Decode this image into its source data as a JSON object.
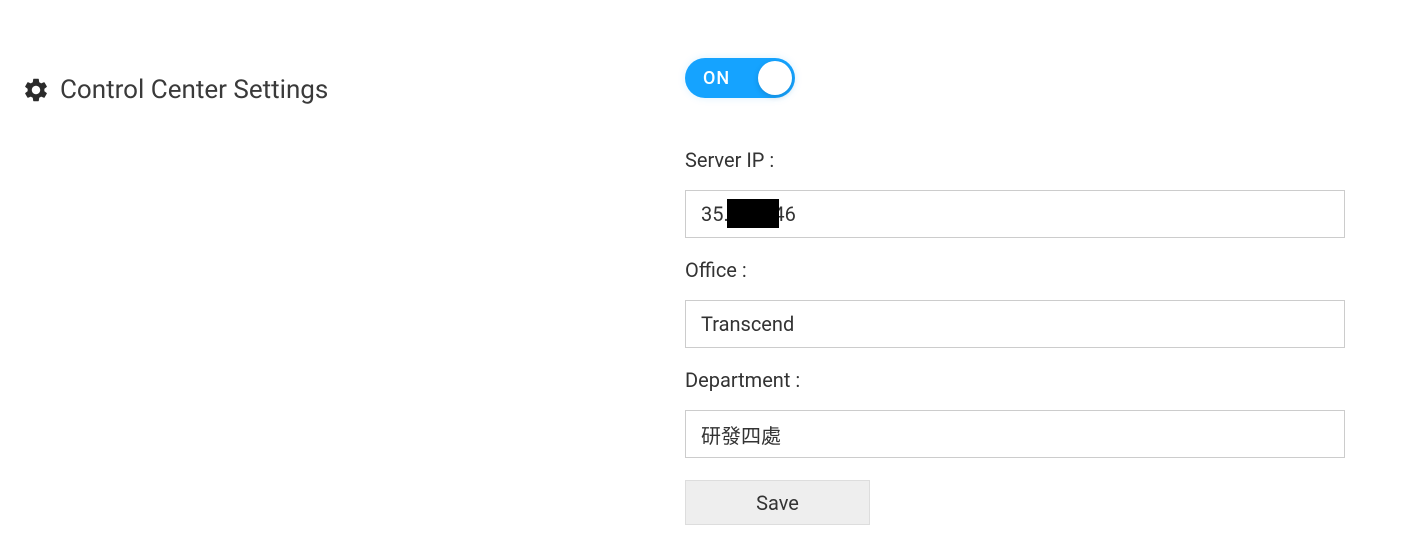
{
  "header": {
    "title": "Control Center Settings"
  },
  "toggle": {
    "state_label": "ON",
    "active": true
  },
  "form": {
    "server_ip": {
      "label": "Server IP :",
      "value": "35.         46"
    },
    "office": {
      "label": "Office :",
      "value": "Transcend"
    },
    "department": {
      "label": "Department :",
      "value": "研發四處"
    },
    "save_label": "Save"
  }
}
